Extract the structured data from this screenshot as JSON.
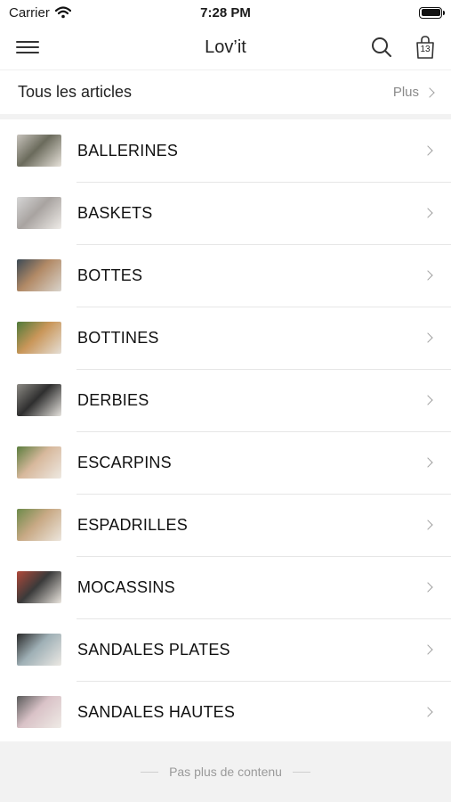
{
  "status_bar": {
    "carrier": "Carrier",
    "time": "7:28 PM",
    "icons": [
      "wifi-icon",
      "battery-icon"
    ]
  },
  "nav_bar": {
    "title": "Lov’it",
    "icons": [
      "menu-icon",
      "search-icon",
      "shopping-bag-icon"
    ],
    "cart_count": "13"
  },
  "section": {
    "title": "Tous les articles",
    "more_label": "Plus"
  },
  "categories": [
    {
      "label": "BALLERINES",
      "thumb_colors": [
        "#c7c3bc",
        "#6b6b5c",
        "#e7e2da"
      ]
    },
    {
      "label": "BASKETS",
      "thumb_colors": [
        "#d6d6d6",
        "#a8a3a0",
        "#efece8"
      ]
    },
    {
      "label": "BOTTES",
      "thumb_colors": [
        "#3c4a55",
        "#b28a66",
        "#d9d4cc"
      ]
    },
    {
      "label": "BOTTINES",
      "thumb_colors": [
        "#4f7a3a",
        "#c99659",
        "#e5dfd6"
      ]
    },
    {
      "label": "DERBIES",
      "thumb_colors": [
        "#8c8a84",
        "#2f2f2f",
        "#e6e3de"
      ]
    },
    {
      "label": "ESCARPINS",
      "thumb_colors": [
        "#5b7d3e",
        "#d7b89c",
        "#eee9e2"
      ]
    },
    {
      "label": "ESPADRILLES",
      "thumb_colors": [
        "#6d8a4a",
        "#c8a985",
        "#ece6dd"
      ]
    },
    {
      "label": "MOCASSINS",
      "thumb_colors": [
        "#b0493a",
        "#3a3a3a",
        "#ebe6df"
      ]
    },
    {
      "label": "SANDALES PLATES",
      "thumb_colors": [
        "#2a2a2a",
        "#9fb0b6",
        "#ece9e4"
      ]
    },
    {
      "label": "SANDALES HAUTES",
      "thumb_colors": [
        "#5a5a5a",
        "#d9c2c7",
        "#efebe6"
      ]
    }
  ],
  "footer": {
    "text": "Pas plus de contenu"
  }
}
